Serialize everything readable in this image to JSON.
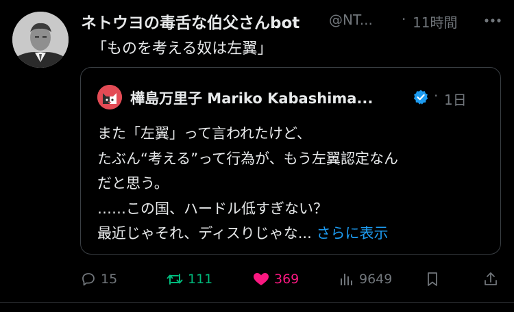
{
  "post": {
    "author_name": "ネトウヨの毒舌な伯父さんbot",
    "author_handle": "@NT...",
    "separator": "·",
    "time": "11時間",
    "text": "「ものを考える奴は左翼」"
  },
  "quote": {
    "author_name": "樺島万里子 Mariko Kabashima...",
    "separator": "·",
    "time": "1日",
    "lines": [
      "また「左翼」って言われたけど、",
      "たぶん“考える”って行為が、もう左翼認定なん",
      "だと思う。",
      "……この国、ハードル低すぎない？",
      "最近じゃそれ、ディスりじゃな..."
    ],
    "show_more": "さらに表示"
  },
  "actions": {
    "replies": "15",
    "reposts": "111",
    "likes": "369",
    "views": "9649"
  },
  "colors": {
    "background": "#000000",
    "text": "#e7e9ea",
    "muted": "#71767b",
    "link": "#1d9bf0",
    "repost": "#00ba7c",
    "like": "#f91880",
    "verified": "#1d9bf0"
  },
  "icons": [
    "more-icon",
    "verified-icon",
    "reply-icon",
    "repost-icon",
    "like-icon",
    "views-icon",
    "bookmark-icon",
    "share-icon"
  ]
}
